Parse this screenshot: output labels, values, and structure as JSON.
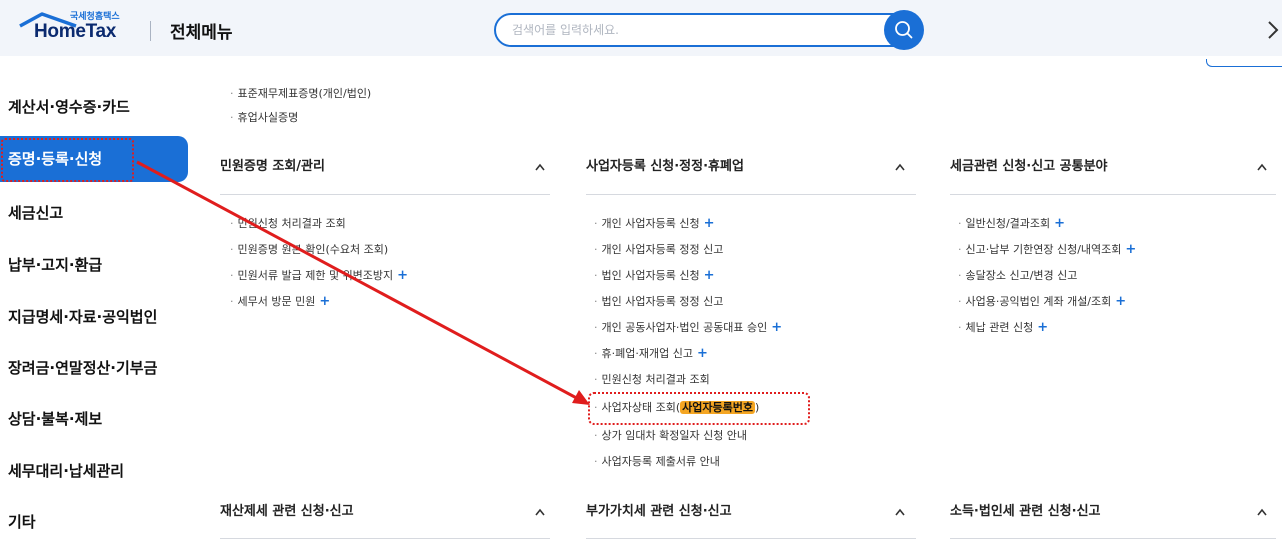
{
  "header": {
    "logo_small": "국세청홈택스",
    "logo_text": "HomeTax",
    "menu_title": "전체메뉴",
    "search_placeholder": "검색어를 입력하세요.",
    "accent_color": "#1a6fd6"
  },
  "sidebar": {
    "items": [
      {
        "label": "계산서·영수증·카드"
      },
      {
        "label": "증명·등록·신청",
        "active": true
      },
      {
        "label": "세금신고"
      },
      {
        "label": "납부·고지·환급"
      },
      {
        "label": "지급명세·자료·공익법인"
      },
      {
        "label": "장려금·연말정산·기부금"
      },
      {
        "label": "상담·불복·제보"
      },
      {
        "label": "세무대리·납세관리"
      },
      {
        "label": "기타"
      }
    ]
  },
  "content": {
    "top_items": [
      "표준재무제표증명(개인/법인)",
      "휴업사실증명"
    ],
    "sections": [
      {
        "title": "민원증명 조회/관리",
        "items": [
          {
            "label": "민원신청 처리결과 조회",
            "plus": false
          },
          {
            "label": "민원증명 원본 확인(수요처 조회)",
            "plus": false
          },
          {
            "label": "민원서류 발급 제한 및 위변조방지",
            "plus": true
          },
          {
            "label": "세무서 방문 민원",
            "plus": true
          }
        ]
      },
      {
        "title": "사업자등록 신청·정정·휴폐업",
        "items": [
          {
            "label": "개인 사업자등록 신청",
            "plus": true
          },
          {
            "label": "개인 사업자등록 정정 신고",
            "plus": false
          },
          {
            "label": "법인 사업자등록 신청",
            "plus": true
          },
          {
            "label": "법인 사업자등록 정정 신고",
            "plus": false
          },
          {
            "label": "개인 공동사업자·법인 공동대표 승인",
            "plus": true
          },
          {
            "label": "휴·폐업·재개업 신고",
            "plus": true
          },
          {
            "label": "민원신청 처리결과 조회",
            "plus": false
          },
          {
            "label": "사업자상태 조회(",
            "hl": "사업자등록번호",
            "suffix": ")",
            "plus": false
          },
          {
            "label": "상가 임대차 확정일자 신청 안내",
            "plus": false
          },
          {
            "label": "사업자등록 제출서류 안내",
            "plus": false
          }
        ]
      },
      {
        "title": "세금관련 신청·신고 공통분야",
        "items": [
          {
            "label": "일반신청/결과조회",
            "plus": true
          },
          {
            "label": "신고·납부 기한연장 신청/내역조회",
            "plus": true
          },
          {
            "label": "송달장소 신고/변경 신고",
            "plus": false
          },
          {
            "label": "사업용·공익법인 계좌 개설/조회",
            "plus": true
          },
          {
            "label": "체납 관련 신청",
            "plus": true
          }
        ]
      }
    ],
    "bottom_sections": [
      {
        "title": "재산제세 관련 신청·신고"
      },
      {
        "title": "부가가치세 관련 신청·신고"
      },
      {
        "title": "소득·법인세 관련 신청·신고"
      }
    ],
    "plus_symbol": "+",
    "bullet_symbol": "·"
  }
}
